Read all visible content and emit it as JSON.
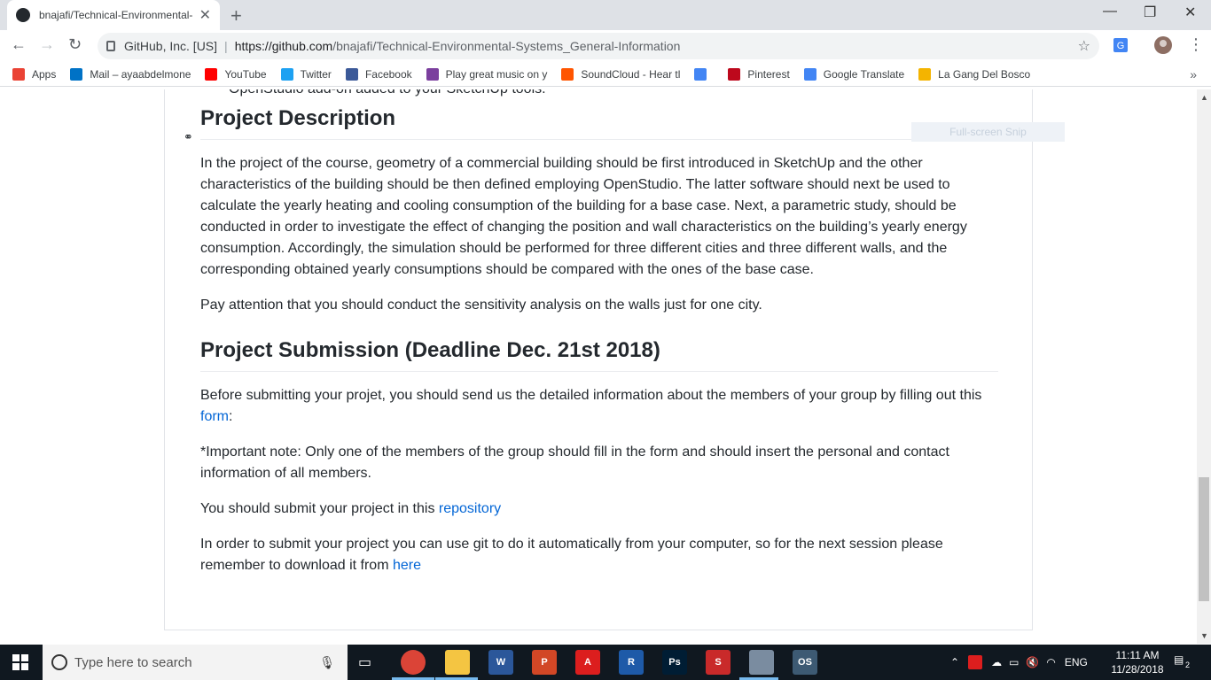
{
  "browser": {
    "tab_title": "bnajafi/Technical-Environmental-",
    "tab_close": "✕",
    "new_tab": "+",
    "cert_label": "GitHub, Inc. [US]",
    "separator": "|",
    "url_host": "https://github.com",
    "url_path": "/bnajafi/Technical-Environmental-Systems_General-Information"
  },
  "bookmarks": [
    {
      "label": "Apps",
      "icon": "apps-grid-icon",
      "color": "#ea4335"
    },
    {
      "label": "Mail – ayaabdelmone",
      "icon": "outlook-icon",
      "color": "#0072c6"
    },
    {
      "label": "YouTube",
      "icon": "youtube-icon",
      "color": "#ff0000"
    },
    {
      "label": "Twitter",
      "icon": "twitter-icon",
      "color": "#1da1f2"
    },
    {
      "label": "Facebook",
      "icon": "facebook-icon",
      "color": "#3b5998"
    },
    {
      "label": "Play great music on y",
      "icon": "music-icon",
      "color": "#7b3f9e"
    },
    {
      "label": "SoundCloud - Hear tl",
      "icon": "soundcloud-icon",
      "color": "#ff5500"
    },
    {
      "label": "",
      "icon": "google-icon",
      "color": "#4285f4"
    },
    {
      "label": "Pinterest",
      "icon": "pinterest-icon",
      "color": "#bd081c"
    },
    {
      "label": "Google Translate",
      "icon": "translate-icon",
      "color": "#4285f4"
    },
    {
      "label": "La Gang Del Bosco",
      "icon": "drive-icon",
      "color": "#f4b400"
    }
  ],
  "readme": {
    "prev_item": "OpenStudio add-on added to your SketchUp tools.",
    "section1_title": "Project Description",
    "section1_p1": "In the project of the course, geometry of a commercial building should be first introduced in SketchUp and the other characteristics of the building should be then defined employing OpenStudio. The latter software should next be used to calculate the yearly heating and cooling consumption of the building for a base case. Next, a parametric study, should be conducted in order to investigate the effect of changing the position and wall characteristics on the building’s yearly energy consumption. Accordingly, the simulation should be performed for three different cities and three different walls, and the corresponding obtained yearly consumptions should be compared with the ones of the base case.",
    "section1_p2": "Pay attention that you should conduct the sensitivity analysis on the walls just for one city.",
    "section2_title": "Project Submission (Deadline Dec. 21st 2018)",
    "section2_p1_text": "Before submitting your projet, you should send us the detailed information about the members of your group by filling out this",
    "section2_p1_link": "form",
    "section2_p1_end": ":",
    "section2_p2": "*Important note: Only one of the members of the group should fill in the form and should insert the personal and contact information of all members.",
    "section2_p3_text": "You should submit your project in this",
    "section2_p3_link": "repository",
    "section2_p4_text": "In order to submit your project you can use git to do it automatically from your computer, so for the next session please remember to download it from",
    "section2_p4_link": "here",
    "snip_overlay": "Full-screen Snip"
  },
  "taskbar": {
    "search_placeholder": "Type here to search",
    "apps": [
      {
        "name": "chrome",
        "label": "",
        "color": "#db4437"
      },
      {
        "name": "file-explorer",
        "label": "",
        "color": "#f4c542"
      },
      {
        "name": "word",
        "label": "W",
        "color": "#2b579a"
      },
      {
        "name": "powerpoint",
        "label": "P",
        "color": "#d24726"
      },
      {
        "name": "acrobat",
        "label": "A",
        "color": "#dc1e1e"
      },
      {
        "name": "revit",
        "label": "R",
        "color": "#1e5aa8"
      },
      {
        "name": "photoshop",
        "label": "Ps",
        "color": "#001d34"
      },
      {
        "name": "sketchup",
        "label": "S",
        "color": "#c92a2a"
      },
      {
        "name": "paint",
        "label": "",
        "color": "#7a8ca0"
      },
      {
        "name": "openstudio",
        "label": "OS",
        "color": "#3d5a73"
      }
    ],
    "language": "ENG",
    "time": "11:11 AM",
    "date": "11/28/2018",
    "notifications": "2"
  }
}
